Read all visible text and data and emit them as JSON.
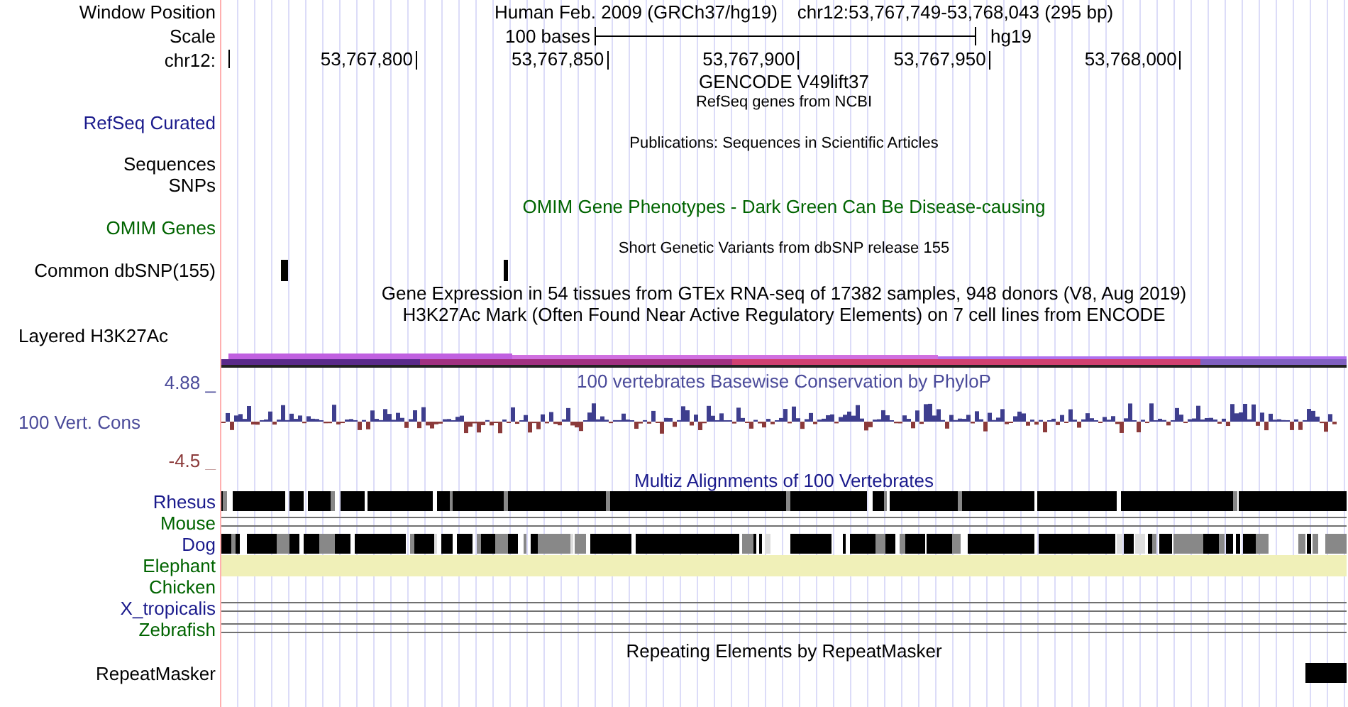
{
  "rows": [
    {
      "kind": "title",
      "label": "Window Position",
      "text": "Human Feb. 2009 (GRCh37/hg19)",
      "position": "chr12:53,767,749-53,768,043 (295 bp)"
    },
    {
      "kind": "scale",
      "label": "Scale",
      "scale_text": "100 bases",
      "assembly": "hg19"
    },
    {
      "kind": "ruler",
      "label": "chr12:",
      "ticks": [
        "53,767,800",
        "53,767,850",
        "53,767,900",
        "53,767,950",
        "53,768,000"
      ]
    },
    {
      "kind": "caption",
      "text": "GENCODE V49lift37",
      "color": "#000000"
    },
    {
      "kind": "small",
      "text": "RefSeq genes from NCBI"
    },
    {
      "kind": "label",
      "label": "RefSeq Curated",
      "color": "#1a1a8c"
    },
    {
      "kind": "small",
      "text": "Publications: Sequences in Scientific Articles"
    },
    {
      "kind": "label",
      "label": "Sequences",
      "color": "#000000"
    },
    {
      "kind": "label",
      "label": "SNPs",
      "color": "#000000"
    },
    {
      "kind": "caption",
      "text": "OMIM Gene Phenotypes - Dark Green Can Be Disease-causing",
      "color": "#006400"
    },
    {
      "kind": "label",
      "label": "OMIM Genes",
      "color": "#006400"
    },
    {
      "kind": "small",
      "text": "Short Genetic Variants from dbSNP release 155"
    },
    {
      "kind": "snp",
      "label": "Common dbSNP(155)",
      "color": "#000000"
    },
    {
      "kind": "caption",
      "text": "Gene Expression in 54 tissues from GTEx RNA-seq of 17382 samples, 948 donors (V8, Aug 2019)",
      "color": "#000000"
    },
    {
      "kind": "caption",
      "text": "H3K27Ac Mark (Often Found Near Active Regulatory Elements) on 7 cell lines from ENCODE",
      "color": "#000000"
    },
    {
      "kind": "group_label",
      "label": "Layered H3K27Ac"
    },
    {
      "kind": "bars"
    },
    {
      "kind": "wiggle_top",
      "label": "4.88 _",
      "text": "100 vertebrates Basewise Conservation by PhyloP",
      "color": "#4b4b9a"
    },
    {
      "kind": "wiggle",
      "label": "100 Vert. Cons",
      "color": "#4b4b9a"
    },
    {
      "kind": "wiggle_bottom",
      "label": "-4.5 _",
      "color": "#8b3a3a"
    },
    {
      "kind": "caption",
      "text": "Multiz Alignments of 100 Vertebrates",
      "color": "#1a1a8c"
    },
    {
      "kind": "blocks",
      "label": "Rhesus",
      "color": "#1a1a8c"
    },
    {
      "kind": "lines",
      "label": "Mouse",
      "color": "#006400"
    },
    {
      "kind": "blocks",
      "label": "Dog",
      "color": "#1a1a8c"
    },
    {
      "kind": "fill",
      "label": "Elephant",
      "color": "#006400"
    },
    {
      "kind": "empty",
      "label": "Chicken",
      "color": "#006400"
    },
    {
      "kind": "lines",
      "label": "X_tropicalis",
      "color": "#1a1a8c"
    },
    {
      "kind": "lines",
      "label": "Zebrafish",
      "color": "#006400"
    },
    {
      "kind": "caption",
      "text": "Repeating Elements by RepeatMasker",
      "color": "#000000"
    },
    {
      "kind": "repeat",
      "label": "RepeatMasker",
      "color": "#000000"
    }
  ]
}
